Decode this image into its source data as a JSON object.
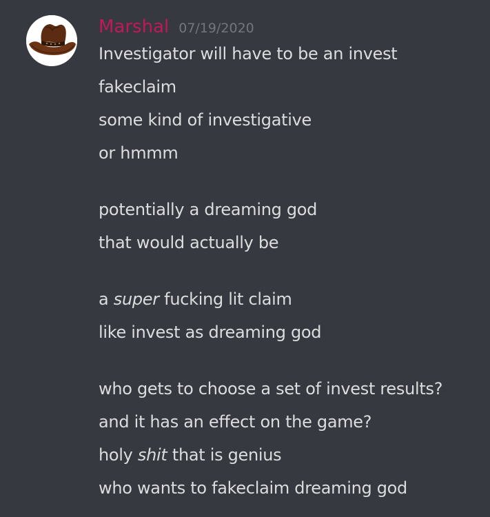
{
  "message": {
    "author": "Marshal",
    "timestamp": "07/19/2020",
    "avatar_icon": "cowboy-hat-icon",
    "username_color": "#c2185b",
    "lines": [
      {
        "before": "Investigator will have to be an invest",
        "italic": "",
        "after": ""
      },
      {
        "before": "fakeclaim",
        "italic": "",
        "after": ""
      },
      {
        "before": "some kind of investigative",
        "italic": "",
        "after": ""
      },
      {
        "before": "or hmmm",
        "italic": "",
        "after": ""
      },
      {
        "before": "potentially a dreaming god",
        "italic": "",
        "after": ""
      },
      {
        "before": "that would actually be",
        "italic": "",
        "after": ""
      },
      {
        "before": "a ",
        "italic": "super",
        "after": " fucking lit claim"
      },
      {
        "before": "like invest as dreaming god",
        "italic": "",
        "after": ""
      },
      {
        "before": "who gets to choose a set of invest results?",
        "italic": "",
        "after": ""
      },
      {
        "before": "and it has an effect on the game?",
        "italic": "",
        "after": ""
      },
      {
        "before": "holy ",
        "italic": "shit",
        "after": " that is genius"
      },
      {
        "before": "who wants to fakeclaim dreaming god",
        "italic": "",
        "after": ""
      }
    ]
  },
  "colors": {
    "background": "#36393f",
    "text": "#dcddde",
    "timestamp": "#72767d"
  }
}
